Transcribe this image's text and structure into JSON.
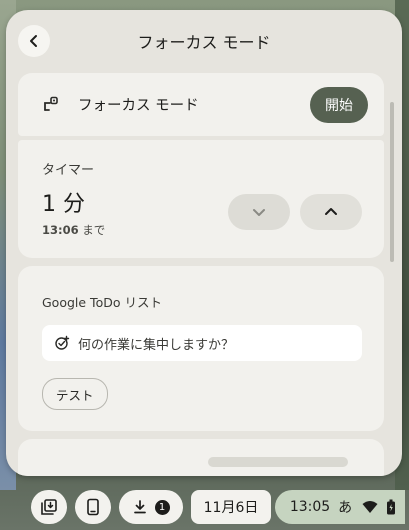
{
  "header": {
    "title": "フォーカス モード"
  },
  "focus_card": {
    "label": "フォーカス モード",
    "start_label": "開始"
  },
  "timer": {
    "label": "タイマー",
    "value": "1 分",
    "until_time": "13:06",
    "until_suffix": " まで"
  },
  "todo": {
    "title": "Google ToDo リスト",
    "placeholder": "何の作業に集中しますか？",
    "chips": [
      "テスト"
    ]
  },
  "shelf": {
    "download_count": "1",
    "date": "11月6日",
    "time": "13:05",
    "ime": "あ"
  },
  "colors": {
    "panel_bg": "#e6e4de",
    "card_bg": "#f2f1ed",
    "accent": "#566151",
    "status_bg": "#c6d4c0"
  },
  "icons": [
    "back-arrow-icon",
    "focus-mode-icon",
    "chevron-down-icon",
    "chevron-up-icon",
    "add-task-icon",
    "holding-space-icon",
    "phone-icon",
    "download-icon",
    "wifi-icon",
    "battery-icon"
  ]
}
